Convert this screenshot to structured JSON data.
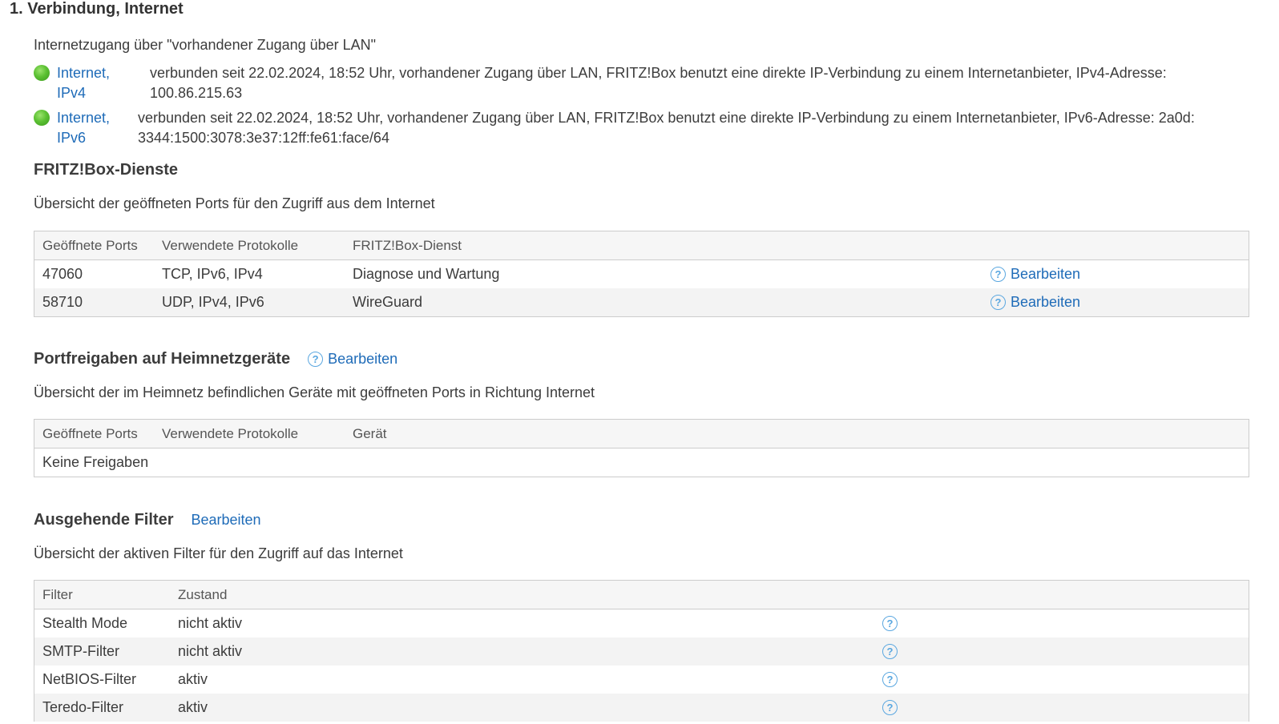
{
  "page": {
    "title": "1. Verbindung, Internet",
    "access_text": "Internetzugang über \"vorhandener Zugang über LAN\""
  },
  "connections": [
    {
      "label_line1": "Internet,",
      "label_line2": "IPv4",
      "text_line1": "verbunden seit 22.02.2024, 18:52 Uhr, vorhandener Zugang über LAN, FRITZ!Box benutzt eine direkte IP-Verbindung zu einem Internetanbieter, IPv4-Adresse:",
      "text_line2": "100.86.215.63",
      "status_color": "#5cc133"
    },
    {
      "label_line1": "Internet,",
      "label_line2": "IPv6",
      "text_line1": "verbunden seit 22.02.2024, 18:52 Uhr, vorhandener Zugang über LAN, FRITZ!Box benutzt eine direkte IP-Verbindung zu einem Internetanbieter, IPv6-Adresse: 2a0d:",
      "text_line2": "3344:1500:3078:3e37:12ff:fe61:face/64",
      "status_color": "#5cc133"
    }
  ],
  "services": {
    "heading": "FRITZ!Box-Dienste",
    "subtitle": "Übersicht der geöffneten Ports für den Zugriff aus dem Internet",
    "columns": [
      "Geöffnete Ports",
      "Verwendete Protokolle",
      "FRITZ!Box-Dienst"
    ],
    "rows": [
      {
        "port": "47060",
        "protocols": "TCP, IPv6, IPv4",
        "service": "Diagnose und Wartung",
        "edit": "Bearbeiten"
      },
      {
        "port": "58710",
        "protocols": "UDP, IPv4, IPv6",
        "service": "WireGuard",
        "edit": "Bearbeiten"
      }
    ]
  },
  "port_forwarding": {
    "heading": "Portfreigaben auf Heimnetzgeräte",
    "edit": "Bearbeiten",
    "subtitle": "Übersicht der im Heimnetz befindlichen Geräte mit geöffneten Ports in Richtung Internet",
    "columns": [
      "Geöffnete Ports",
      "Verwendete Protokolle",
      "Gerät"
    ],
    "empty_text": "Keine Freigaben"
  },
  "filters": {
    "heading": "Ausgehende Filter",
    "edit": "Bearbeiten",
    "subtitle": "Übersicht der aktiven Filter für den Zugriff auf das Internet",
    "columns": [
      "Filter",
      "Zustand"
    ],
    "rows": [
      {
        "name": "Stealth Mode",
        "state": "nicht aktiv"
      },
      {
        "name": "SMTP-Filter",
        "state": "nicht aktiv"
      },
      {
        "name": "NetBIOS-Filter",
        "state": "aktiv"
      },
      {
        "name": "Teredo-Filter",
        "state": "aktiv"
      }
    ]
  },
  "icons": {
    "help": "?"
  },
  "colors": {
    "link": "#1e6bb8",
    "help_icon": "#5aa7e0",
    "status_ok": "#5cc133"
  }
}
